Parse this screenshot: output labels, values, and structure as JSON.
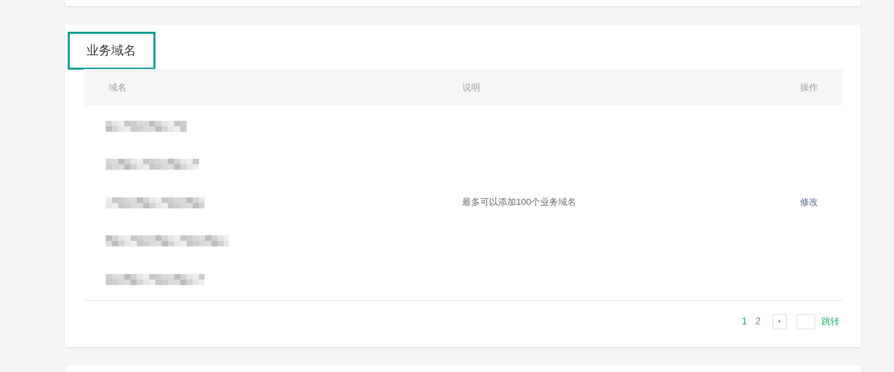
{
  "section": {
    "title": "业务域名",
    "highlighted": true
  },
  "table": {
    "columns": [
      "域名",
      "说明",
      "操作"
    ],
    "rows": [
      {
        "kind": "redacted"
      },
      {
        "kind": "redacted"
      },
      {
        "kind": "redacted"
      },
      {
        "kind": "redacted"
      },
      {
        "kind": "redacted"
      }
    ],
    "description": "最多可以添加100个业务域名",
    "action": "修改"
  },
  "pagination": {
    "pages": [
      {
        "label": "1",
        "selected": true
      },
      {
        "label": "2",
        "selected": false
      }
    ],
    "jump": "跳转"
  }
}
